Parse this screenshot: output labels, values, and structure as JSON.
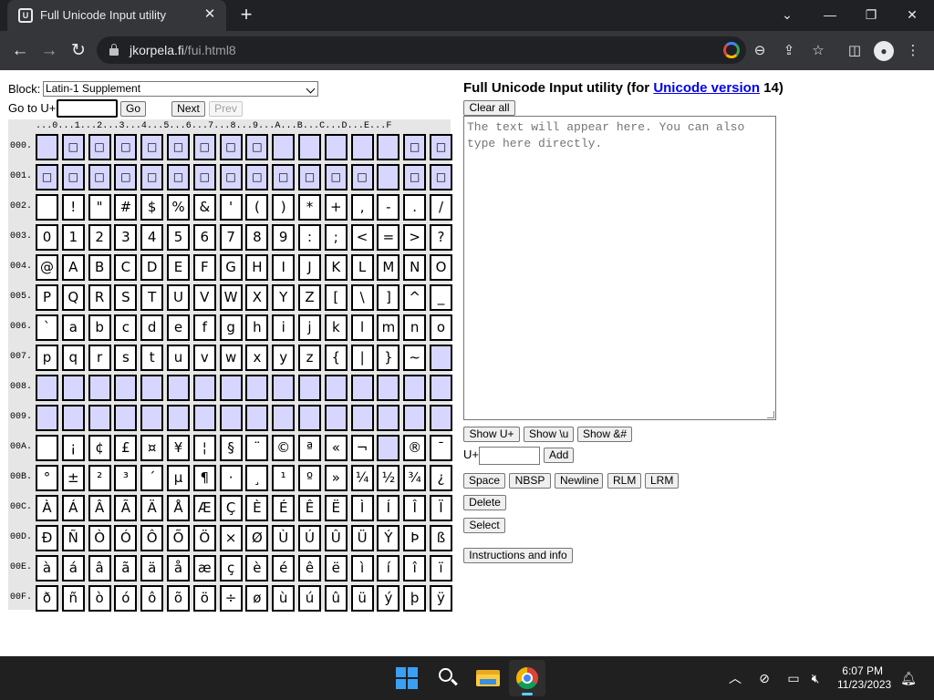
{
  "browser": {
    "tab_title": "Full Unicode Input utility",
    "tab_favicon": "U",
    "url_host": "jkorpela.fi",
    "url_path": "/fui.html8",
    "icons": [
      "back-arrow-icon",
      "forward-arrow-icon",
      "reload-icon",
      "lock-icon",
      "google-lens-icon",
      "zoom-icon",
      "share-icon",
      "bookmark-star-icon",
      "side-panel-icon",
      "profile-icon",
      "menu-icon"
    ]
  },
  "controls": {
    "block_label": "Block:",
    "block_value": "Latin-1 Supplement",
    "goto_label": "Go to U+",
    "go_label": "Go",
    "next_label": "Next",
    "prev_label": "Prev"
  },
  "grid": {
    "header": "...0...1...2...3...4...5...6...7...8...9...A...B...C...D...E...F",
    "rows": [
      {
        "label": "000.",
        "cells": [
          "",
          "□",
          "□",
          "□",
          "□",
          "□",
          "□",
          "□",
          "□",
          "",
          "",
          "",
          "",
          "",
          "□",
          "□"
        ]
      },
      {
        "label": "001.",
        "cells": [
          "□",
          "□",
          "□",
          "□",
          "□",
          "□",
          "□",
          "□",
          "□",
          "□",
          "□",
          "□",
          "□",
          "",
          "□",
          "□"
        ]
      },
      {
        "label": "002.",
        "cells": [
          "",
          "!",
          "\"",
          "#",
          "$",
          "%",
          "&",
          "'",
          "(",
          ")",
          "*",
          "+",
          ",",
          "-",
          ".",
          "/"
        ]
      },
      {
        "label": "003.",
        "cells": [
          "0",
          "1",
          "2",
          "3",
          "4",
          "5",
          "6",
          "7",
          "8",
          "9",
          ":",
          ";",
          "<",
          "=",
          ">",
          "?"
        ]
      },
      {
        "label": "004.",
        "cells": [
          "@",
          "A",
          "B",
          "C",
          "D",
          "E",
          "F",
          "G",
          "H",
          "I",
          "J",
          "K",
          "L",
          "M",
          "N",
          "O"
        ]
      },
      {
        "label": "005.",
        "cells": [
          "P",
          "Q",
          "R",
          "S",
          "T",
          "U",
          "V",
          "W",
          "X",
          "Y",
          "Z",
          "[",
          "\\",
          "]",
          "^",
          "_"
        ]
      },
      {
        "label": "006.",
        "cells": [
          "`",
          "a",
          "b",
          "c",
          "d",
          "e",
          "f",
          "g",
          "h",
          "i",
          "j",
          "k",
          "l",
          "m",
          "n",
          "o"
        ]
      },
      {
        "label": "007.",
        "cells": [
          "p",
          "q",
          "r",
          "s",
          "t",
          "u",
          "v",
          "w",
          "x",
          "y",
          "z",
          "{",
          "|",
          "}",
          "~",
          ""
        ]
      },
      {
        "label": "008.",
        "cells": [
          "",
          "",
          "",
          "",
          "",
          "",
          "",
          "",
          "",
          "",
          "",
          "",
          "",
          "",
          "",
          ""
        ]
      },
      {
        "label": "009.",
        "cells": [
          "",
          "",
          "",
          "",
          "",
          "",
          "",
          "",
          "",
          "",
          "",
          "",
          "",
          "",
          "",
          ""
        ]
      },
      {
        "label": "00A.",
        "cells": [
          "",
          "¡",
          "¢",
          "£",
          "¤",
          "¥",
          "¦",
          "§",
          "¨",
          "©",
          "ª",
          "«",
          "¬",
          "",
          "®",
          "¯"
        ]
      },
      {
        "label": "00B.",
        "cells": [
          "°",
          "±",
          "²",
          "³",
          "´",
          "µ",
          "¶",
          "·",
          "¸",
          "¹",
          "º",
          "»",
          "¼",
          "½",
          "¾",
          "¿"
        ]
      },
      {
        "label": "00C.",
        "cells": [
          "À",
          "Á",
          "Â",
          "Ã",
          "Ä",
          "Å",
          "Æ",
          "Ç",
          "È",
          "É",
          "Ê",
          "Ë",
          "Ì",
          "Í",
          "Î",
          "Ï"
        ]
      },
      {
        "label": "00D.",
        "cells": [
          "Ð",
          "Ñ",
          "Ò",
          "Ó",
          "Ô",
          "Õ",
          "Ö",
          "×",
          "Ø",
          "Ù",
          "Ú",
          "Û",
          "Ü",
          "Ý",
          "Þ",
          "ß"
        ]
      },
      {
        "label": "00E.",
        "cells": [
          "à",
          "á",
          "â",
          "ã",
          "ä",
          "å",
          "æ",
          "ç",
          "è",
          "é",
          "ê",
          "ë",
          "ì",
          "í",
          "î",
          "ï"
        ]
      },
      {
        "label": "00F.",
        "cells": [
          "ð",
          "ñ",
          "ò",
          "ó",
          "ô",
          "õ",
          "ö",
          "÷",
          "ø",
          "ù",
          "ú",
          "û",
          "ü",
          "ý",
          "þ",
          "ÿ"
        ]
      }
    ]
  },
  "panel": {
    "title_prefix": "Full Unicode Input utility (for ",
    "title_link": "Unicode version",
    "title_suffix": " 14)",
    "clear_label": "Clear all",
    "textarea_placeholder": "The text will appear here. You can also type here directly.",
    "show_uplus": "Show U+",
    "show_u": "Show \\u",
    "show_entity": "Show &#",
    "uplus_label": "U+",
    "add_label": "Add",
    "space_label": "Space",
    "nbsp_label": "NBSP",
    "newline_label": "Newline",
    "rlm_label": "RLM",
    "lrm_label": "LRM",
    "delete_label": "Delete",
    "select_label": "Select",
    "instructions_label": "Instructions and info"
  },
  "taskbar": {
    "time": "6:07 PM",
    "date": "11/23/2023"
  },
  "colors": {
    "control_cell": "#d6d6ff",
    "link": "#0000ee",
    "grid_background": "#e6e6e6"
  }
}
